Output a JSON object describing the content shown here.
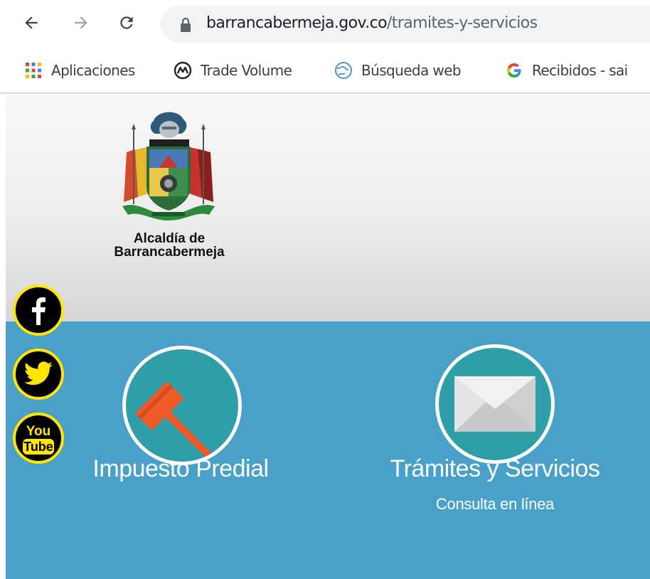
{
  "browser": {
    "url_domain": "barrancabermeja.gov.co",
    "url_path": "/tramites-y-servicios",
    "bookmarks": [
      {
        "label": "Aplicaciones",
        "icon": "apps-grid-icon"
      },
      {
        "label": "Trade Volume",
        "icon": "coinmarketcap-icon"
      },
      {
        "label": "Búsqueda web",
        "icon": "globe-search-icon"
      },
      {
        "label": "Recibidos - sai",
        "icon": "google-icon"
      }
    ]
  },
  "site": {
    "logo_line1": "Alcaldía de",
    "logo_line2": "Barrancabermeja",
    "social": [
      "facebook-icon",
      "twitter-icon",
      "youtube-icon"
    ],
    "youtube_top": "You",
    "youtube_bottom": "Tube"
  },
  "services": [
    {
      "title": "Impuesto Predial",
      "subtitle": "",
      "icon": "gavel-icon"
    },
    {
      "title": "Trámites y Servicios",
      "subtitle": "Consulta en línea",
      "icon": "envelope-icon"
    }
  ],
  "colors": {
    "blue_band": "#49a0c8",
    "circle_fill": "#2e9ea8",
    "gavel": "#f05a28",
    "social_ring": "#ffe600"
  }
}
